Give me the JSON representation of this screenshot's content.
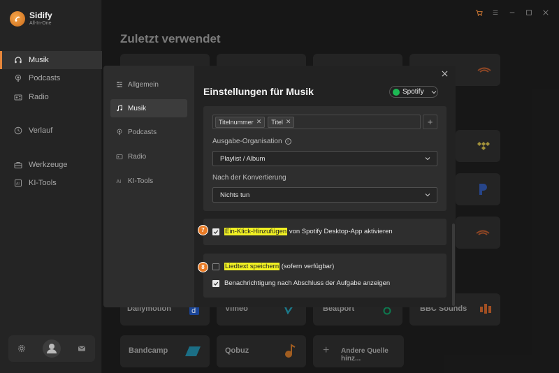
{
  "app": {
    "name": "Sidify",
    "subtitle": "All-In-One"
  },
  "sidebar": {
    "items": [
      {
        "label": "Musik",
        "icon": "headphones-icon",
        "active": true
      },
      {
        "label": "Podcasts",
        "icon": "podcast-icon",
        "active": false
      },
      {
        "label": "Radio",
        "icon": "radio-icon",
        "active": false
      },
      {
        "label": "Verlauf",
        "icon": "clock-icon",
        "active": false
      },
      {
        "label": "Werkzeuge",
        "icon": "toolbox-icon",
        "active": false
      },
      {
        "label": "KI-Tools",
        "icon": "ai-icon",
        "active": false
      }
    ]
  },
  "main": {
    "title": "Zuletzt verwendet",
    "tiles": [
      {
        "label": "Dailymotion"
      },
      {
        "label": "Vimeo"
      },
      {
        "label": "Beatport"
      },
      {
        "label": "BBC Sounds"
      },
      {
        "label": "Bandcamp"
      },
      {
        "label": "Qobuz"
      },
      {
        "label": "Andere Quelle hinz..."
      }
    ]
  },
  "settings": {
    "nav": [
      {
        "label": "Allgemein",
        "icon": "sliders-icon",
        "active": false
      },
      {
        "label": "Musik",
        "icon": "music-note-icon",
        "active": true
      },
      {
        "label": "Podcasts",
        "icon": "podcast-icon",
        "active": false
      },
      {
        "label": "Radio",
        "icon": "radio-icon",
        "active": false
      },
      {
        "label": "KI-Tools",
        "icon": "ai-icon",
        "active": false
      }
    ],
    "title": "Einstellungen für Musik",
    "source": "Spotify",
    "tags": [
      "Titelnummer",
      "Titel"
    ],
    "output_org_label": "Ausgabe-Organisation",
    "output_org_value": "Playlist  /  Album",
    "after_conv_label": "Nach der Konvertierung",
    "after_conv_value": "Nichts tun",
    "one_click": {
      "badge": "7",
      "highlight": "Ein-Klick-Hinzufügen",
      "rest": " von Spotify Desktop-App aktivieren",
      "checked": true
    },
    "lyrics": {
      "badge": "8",
      "highlight": "Liedtext speichern",
      "rest": " (sofern verfügbar)",
      "checked": false
    },
    "notify": {
      "label": "Benachrichtigung nach Abschluss der Aufgabe anzeigen",
      "checked": true
    }
  },
  "colors": {
    "accent": "#e6863a",
    "highlight": "#f1f123",
    "spotify": "#1db954"
  }
}
